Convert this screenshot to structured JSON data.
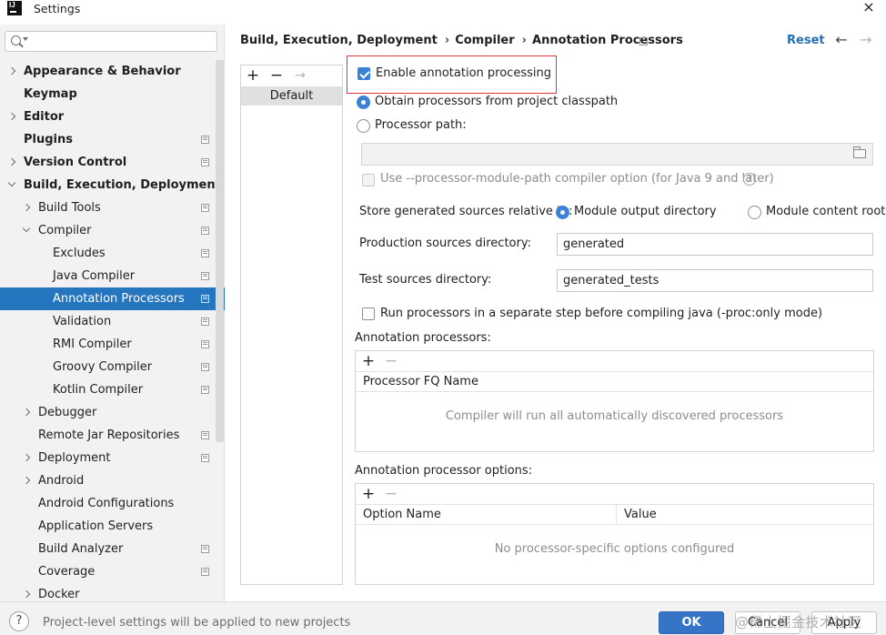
{
  "window": {
    "title": "Settings",
    "close_glyph": "×"
  },
  "sidebar": {
    "search": {
      "placeholder": "",
      "value": ""
    },
    "items": [
      {
        "label": "Appearance & Behavior",
        "bold": true,
        "arrow": "right",
        "indent": 0,
        "project": false,
        "selected": false
      },
      {
        "label": "Keymap",
        "bold": true,
        "arrow": "none",
        "indent": 0,
        "project": false,
        "selected": false
      },
      {
        "label": "Editor",
        "bold": true,
        "arrow": "right",
        "indent": 0,
        "project": false,
        "selected": false
      },
      {
        "label": "Plugins",
        "bold": true,
        "arrow": "none",
        "indent": 0,
        "project": true,
        "selected": false
      },
      {
        "label": "Version Control",
        "bold": true,
        "arrow": "right",
        "indent": 0,
        "project": true,
        "selected": false
      },
      {
        "label": "Build, Execution, Deployment",
        "bold": true,
        "arrow": "down",
        "indent": 0,
        "project": false,
        "selected": false
      },
      {
        "label": "Build Tools",
        "bold": false,
        "arrow": "right",
        "indent": 1,
        "project": true,
        "selected": false
      },
      {
        "label": "Compiler",
        "bold": false,
        "arrow": "down",
        "indent": 1,
        "project": true,
        "selected": false
      },
      {
        "label": "Excludes",
        "bold": false,
        "arrow": "none",
        "indent": 2,
        "project": true,
        "selected": false
      },
      {
        "label": "Java Compiler",
        "bold": false,
        "arrow": "none",
        "indent": 2,
        "project": true,
        "selected": false
      },
      {
        "label": "Annotation Processors",
        "bold": false,
        "arrow": "none",
        "indent": 2,
        "project": true,
        "selected": true
      },
      {
        "label": "Validation",
        "bold": false,
        "arrow": "none",
        "indent": 2,
        "project": true,
        "selected": false
      },
      {
        "label": "RMI Compiler",
        "bold": false,
        "arrow": "none",
        "indent": 2,
        "project": true,
        "selected": false
      },
      {
        "label": "Groovy Compiler",
        "bold": false,
        "arrow": "none",
        "indent": 2,
        "project": true,
        "selected": false
      },
      {
        "label": "Kotlin Compiler",
        "bold": false,
        "arrow": "none",
        "indent": 2,
        "project": true,
        "selected": false
      },
      {
        "label": "Debugger",
        "bold": false,
        "arrow": "right",
        "indent": 1,
        "project": false,
        "selected": false
      },
      {
        "label": "Remote Jar Repositories",
        "bold": false,
        "arrow": "none",
        "indent": 1,
        "project": true,
        "selected": false
      },
      {
        "label": "Deployment",
        "bold": false,
        "arrow": "right",
        "indent": 1,
        "project": true,
        "selected": false
      },
      {
        "label": "Android",
        "bold": false,
        "arrow": "right",
        "indent": 1,
        "project": false,
        "selected": false
      },
      {
        "label": "Android Configurations",
        "bold": false,
        "arrow": "none",
        "indent": 1,
        "project": false,
        "selected": false
      },
      {
        "label": "Application Servers",
        "bold": false,
        "arrow": "none",
        "indent": 1,
        "project": false,
        "selected": false
      },
      {
        "label": "Build Analyzer",
        "bold": false,
        "arrow": "none",
        "indent": 1,
        "project": true,
        "selected": false
      },
      {
        "label": "Coverage",
        "bold": false,
        "arrow": "none",
        "indent": 1,
        "project": true,
        "selected": false
      },
      {
        "label": "Docker",
        "bold": false,
        "arrow": "right",
        "indent": 1,
        "project": false,
        "selected": false
      }
    ]
  },
  "header": {
    "breadcrumb": [
      "Build, Execution, Deployment",
      "Compiler",
      "Annotation Processors"
    ],
    "crumb_separator": "›",
    "reset_label": "Reset",
    "back_glyph": "←",
    "forward_glyph": "→"
  },
  "profiles": {
    "add_glyph": "+",
    "remove_glyph": "−",
    "move_glyph": "→",
    "items": [
      "Default"
    ]
  },
  "options": {
    "enable_label": "Enable annotation processing",
    "enable_checked": true,
    "obtain_label": "Obtain processors from project classpath",
    "processor_path_label": "Processor path:",
    "processor_path_value": "",
    "module_path_label": "Use --processor-module-path compiler option (for Java 9 and later)",
    "help_glyph": "?",
    "store_label": "Store generated sources relative to:",
    "module_output_label": "Module output directory",
    "module_content_label": "Module content root",
    "production_label": "Production sources directory:",
    "production_value": "generated",
    "test_label": "Test sources directory:",
    "test_value": "generated_tests",
    "separate_step_label": "Run processors in a separate step before compiling java (-proc:only mode)"
  },
  "processors_table": {
    "title": "Annotation processors:",
    "add_glyph": "+",
    "remove_glyph": "−",
    "column": "Processor FQ Name",
    "empty_text": "Compiler will run all automatically discovered processors"
  },
  "options_table": {
    "title": "Annotation processor options:",
    "add_glyph": "+",
    "remove_glyph": "−",
    "columns": [
      "Option Name",
      "Value"
    ],
    "empty_text": "No processor-specific options configured"
  },
  "footer": {
    "help_glyph": "?",
    "note": "Project-level settings will be applied to new projects",
    "ok_label": "OK",
    "cancel_label": "Cancel",
    "apply_label": "Apply",
    "watermark": "@稀土掘金技术社区"
  },
  "colors": {
    "accent": "#2675bf",
    "highlight_border": "#e03434",
    "link": "#2470b3"
  }
}
